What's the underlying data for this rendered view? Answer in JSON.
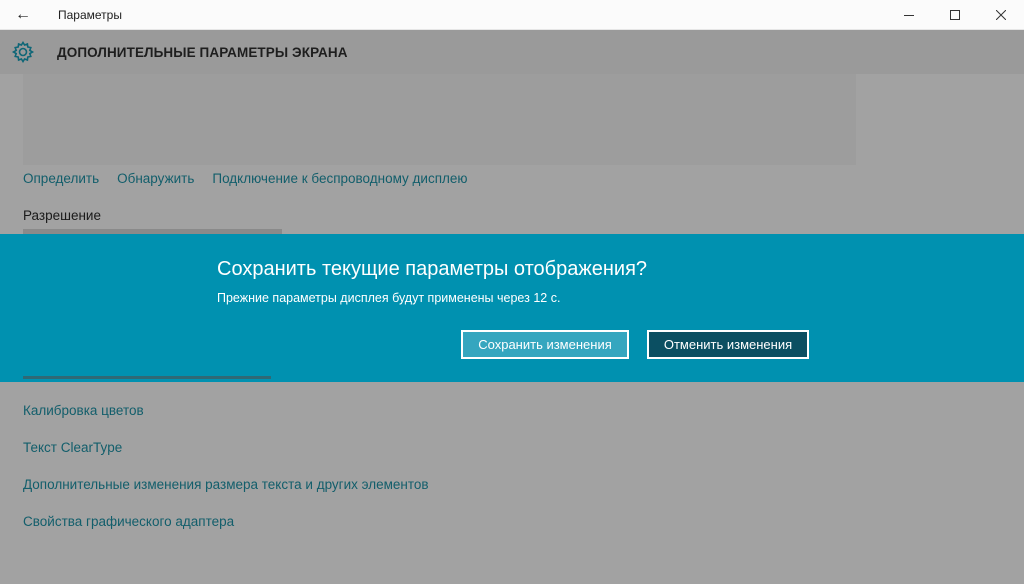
{
  "window": {
    "title": "Параметры",
    "back_icon": "←",
    "minimize_icon": "minimize-icon",
    "maximize_icon": "maximize-icon",
    "close_icon": "close-icon"
  },
  "header": {
    "title": "ДОПОЛНИТЕЛЬНЫЕ ПАРАМЕТРЫ ЭКРАНА",
    "icon": "gear-icon"
  },
  "display_links": [
    "Определить",
    "Обнаружить",
    "Подключение к беспроводному дисплею"
  ],
  "resolution": {
    "label": "Разрешение"
  },
  "dialog": {
    "title": "Сохранить текущие параметры отображения?",
    "message": "Прежние параметры дисплея будут применены через 12 с.",
    "save_label": "Сохранить изменения",
    "revert_label": "Отменить изменения"
  },
  "related_links": [
    "Калибровка цветов",
    "Текст ClearType",
    "Дополнительные изменения размера текста и других элементов",
    "Свойства графического адаптера"
  ],
  "colors": {
    "accent": "#0091b0",
    "link": "#125e6b",
    "overlay": "#a2a2a2"
  }
}
